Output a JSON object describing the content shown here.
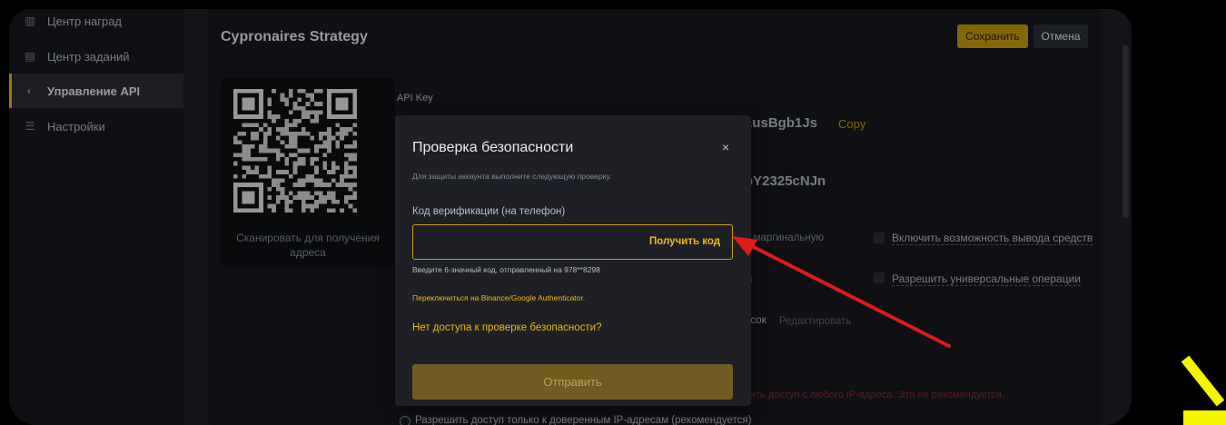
{
  "sidebar": {
    "items": [
      {
        "label": "Центр наград",
        "icon": "reward-icon",
        "active": false
      },
      {
        "label": "Центр заданий",
        "icon": "tasks-icon",
        "active": false
      },
      {
        "label": "Управление API",
        "icon": "api-icon",
        "active": true
      },
      {
        "label": "Настройки",
        "icon": "settings-icon",
        "active": false
      }
    ]
  },
  "header": {
    "title": "Cypronaires Strategy",
    "save_label": "Сохранить",
    "cancel_label": "Отмена"
  },
  "qr": {
    "caption": "Сканировать для получения адреса"
  },
  "api": {
    "label": "API Key",
    "key_fragment": "1usBgb1Js",
    "copy_label": "Copy",
    "secret_fragment": "bY2325cNJn"
  },
  "permissions": {
    "margin_fragment": "и маргинальную",
    "line2_fragment": "ы",
    "list_fragment": "исок",
    "edit_fragment": "Редактировать",
    "withdraw_label": "Включить возможность вывода средств",
    "universal_label": "Разрешить универсальные операции"
  },
  "ip": {
    "warning_fragment": "чить доступ с любого IP-адреса. Это не рекомендуется.",
    "trusted_label": "Разрешить доступ только к доверенным IP-адресам (рекомендуется)"
  },
  "modal": {
    "title": "Проверка безопасности",
    "close": "×",
    "subtitle": "Для защиты аккаунта выполните следующую проверку.",
    "code_label": "Код верификации (на телефон)",
    "code_value": "",
    "get_code_label": "Получить код",
    "hint": "Введите 6-значный код, отправленный на 978**8298",
    "switch_label": "Переключиться на Binance/Google Authenticator.",
    "no_access_label": "Нет доступа к проверке безопасности?",
    "submit_label": "Отправить"
  },
  "colors": {
    "accent": "#f0b90b",
    "arrow": "#e01a1a",
    "deco": "#f5f500"
  }
}
